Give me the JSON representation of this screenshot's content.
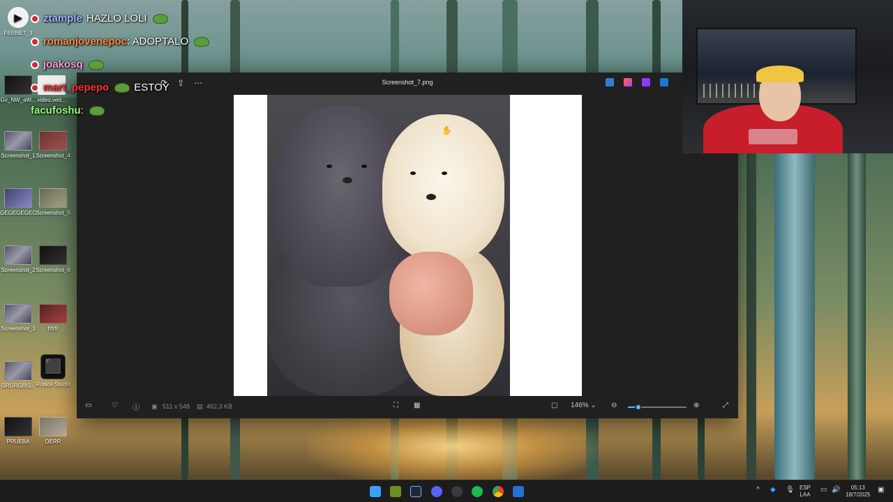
{
  "chat": [
    {
      "user": "ztample",
      "message": "HAZLO LOLI",
      "user_color": "#9ab7ff"
    },
    {
      "user": "romanjovenepoc",
      "message": ": ADOPTALO",
      "user_color": "#ff8a3c"
    },
    {
      "user": "joakosq",
      "message": "",
      "user_color": "#ff9acb"
    },
    {
      "user": "mart_pepepo",
      "message": "ESTOY",
      "user_color": "#ff2f2f"
    },
    {
      "user": "facufoshu",
      "message": ":",
      "user_color": "#93ff7a"
    }
  ],
  "desktop_icons": [
    {
      "label": "FERNET_3"
    },
    {
      "label": "Gv_NW_aW..."
    },
    {
      "label": "video.ved..."
    },
    {
      "label": "Screenshot_1"
    },
    {
      "label": "Screenshot_4"
    },
    {
      "label": "GEGEGEGEG"
    },
    {
      "label": "Screenshot_5"
    },
    {
      "label": "Screenshot_2"
    },
    {
      "label": "Screenshot_6"
    },
    {
      "label": "Screenshot_3"
    },
    {
      "label": "frfrfr"
    },
    {
      "label": "GRGRGRG..."
    },
    {
      "label": "Roblox Studio"
    },
    {
      "label": "PRUEBA"
    },
    {
      "label": "DERR"
    }
  ],
  "viewer": {
    "title": "Screenshot_7.png",
    "dimensions": "511 x 548",
    "file_size": "462.3 KB",
    "zoom": "146%",
    "zoom_level": 0.18
  },
  "tray": {
    "lang_top": "ESP",
    "lang_bottom": "LAA",
    "time": "05:13",
    "date": "18/7/2025"
  },
  "colors": {
    "accent": "#4cc2ff",
    "window_bg": "#202020",
    "taskbar_bg": "#1c1c1c"
  }
}
